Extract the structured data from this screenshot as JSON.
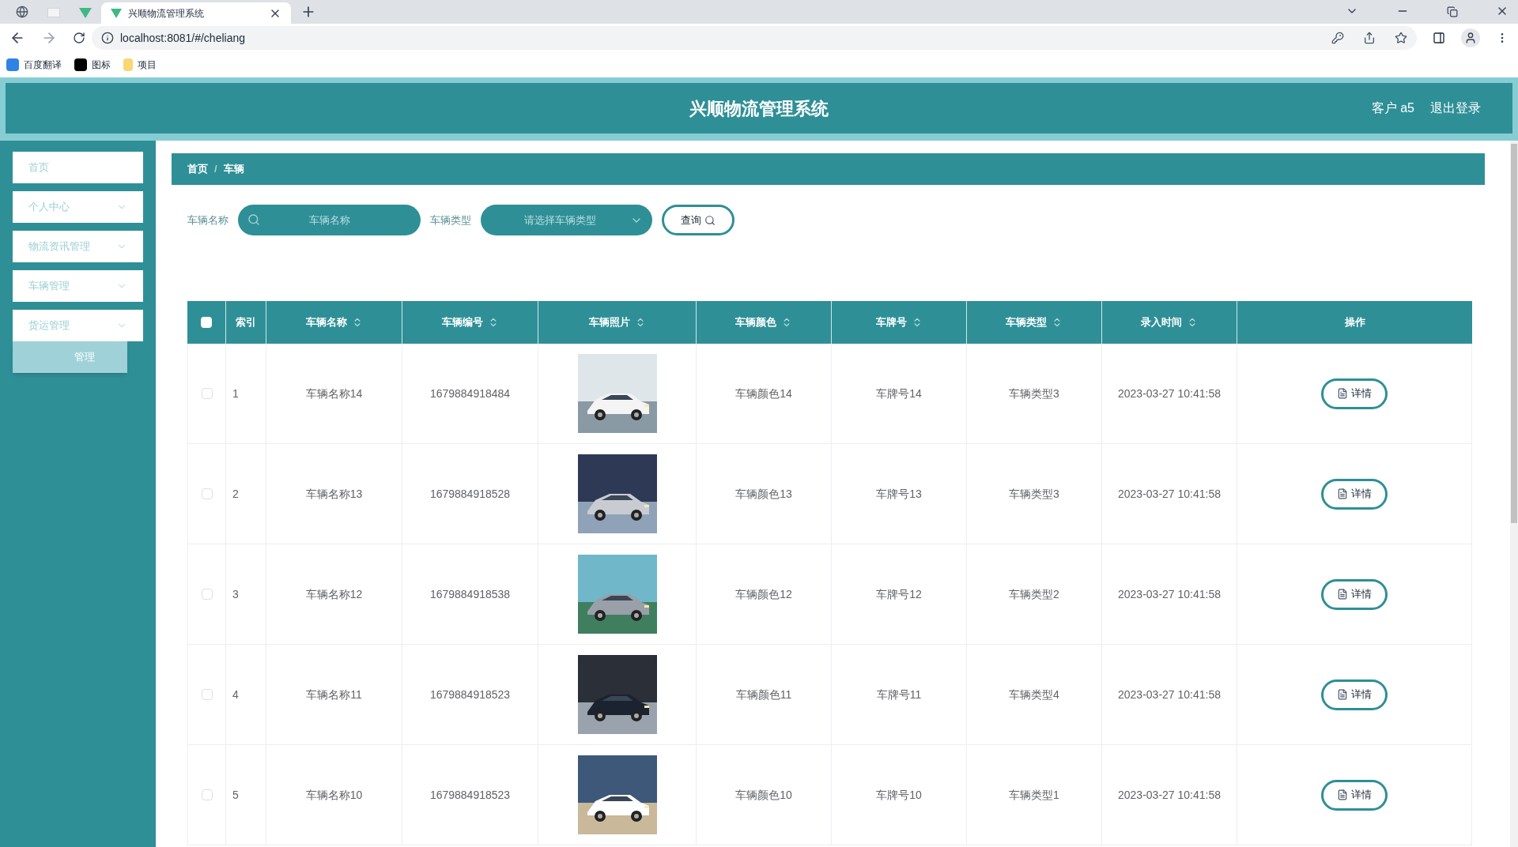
{
  "browser": {
    "tabs": [
      {
        "title": "兴顺物流管理系统",
        "selected": true
      }
    ],
    "url": "localhost:8081/#/cheliang",
    "bookmarks": [
      "百度翻译",
      "图标",
      "项目"
    ]
  },
  "header": {
    "title": "兴顺物流管理系统",
    "user": "客户 a5",
    "logout": "退出登录"
  },
  "sidebar": {
    "items": [
      {
        "label": "首页",
        "expandable": false
      },
      {
        "label": "个人中心",
        "expandable": true
      },
      {
        "label": "物流资讯管理",
        "expandable": true
      },
      {
        "label": "车辆管理",
        "expandable": true
      },
      {
        "label": "货运管理",
        "expandable": true,
        "children": [
          {
            "label": "管理"
          }
        ]
      }
    ]
  },
  "breadcrumb": {
    "separator": "/",
    "items": [
      "首页",
      "车辆"
    ]
  },
  "search": {
    "name_label": "车辆名称",
    "name_placeholder": "车辆名称",
    "type_label": "车辆类型",
    "type_placeholder": "请选择车辆类型",
    "button": "查询"
  },
  "table": {
    "select_all_checked": false,
    "columns": [
      "索引",
      "车辆名称",
      "车辆编号",
      "车辆照片",
      "车辆颜色",
      "车牌号",
      "车辆类型",
      "录入时间",
      "操作"
    ],
    "rows": [
      {
        "checked": false,
        "index": "1",
        "name": "车辆名称14",
        "code": "1679884918484",
        "vehicle_color": "车辆颜色14",
        "plate": "车牌号14",
        "type": "车辆类型3",
        "time": "2023-03-27 10:41:58",
        "action": "详情"
      },
      {
        "checked": false,
        "index": "2",
        "name": "车辆名称13",
        "code": "1679884918528",
        "vehicle_color": "车辆颜色13",
        "plate": "车牌号13",
        "type": "车辆类型3",
        "time": "2023-03-27 10:41:58",
        "action": "详情"
      },
      {
        "checked": false,
        "index": "3",
        "name": "车辆名称12",
        "code": "1679884918538",
        "vehicle_color": "车辆颜色12",
        "plate": "车牌号12",
        "type": "车辆类型2",
        "time": "2023-03-27 10:41:58",
        "action": "详情"
      },
      {
        "checked": false,
        "index": "4",
        "name": "车辆名称11",
        "code": "1679884918523",
        "vehicle_color": "车辆颜色11",
        "plate": "车牌号11",
        "type": "车辆类型4",
        "time": "2023-03-27 10:41:58",
        "action": "详情"
      },
      {
        "checked": false,
        "index": "5",
        "name": "车辆名称10",
        "code": "1679884918523",
        "vehicle_color": "车辆颜色10",
        "plate": "车牌号10",
        "type": "车辆类型1",
        "time": "2023-03-27 10:41:58",
        "action": "详情"
      }
    ]
  }
}
